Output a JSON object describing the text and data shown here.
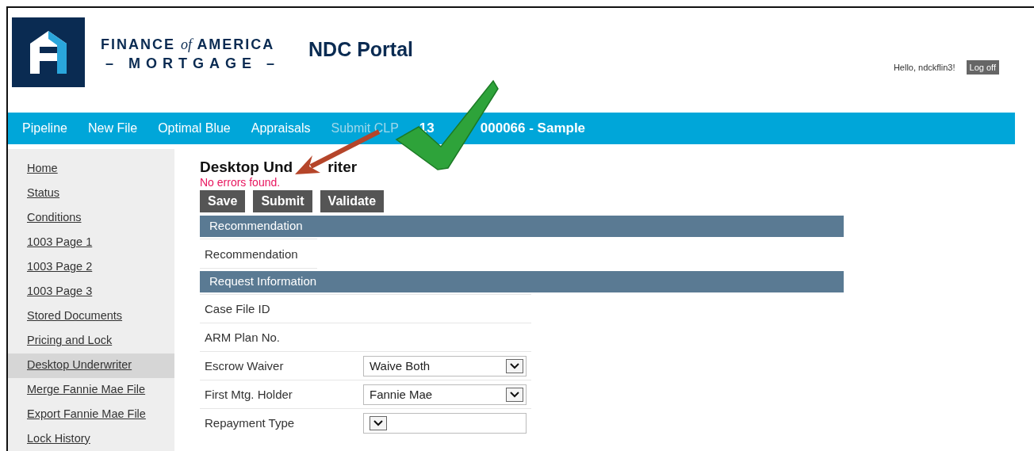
{
  "header": {
    "brand_line1_a": "FINANCE",
    "brand_line1_of": "of",
    "brand_line1_b": "AMERICA",
    "brand_line2": "– MORTGAGE –",
    "portal_title": "NDC Portal",
    "greeting": "Hello, ndckflin3!",
    "logoff": "Log off"
  },
  "nav": {
    "items": [
      {
        "label": "Pipeline",
        "disabled": false
      },
      {
        "label": "New File",
        "disabled": false
      },
      {
        "label": "Optimal Blue",
        "disabled": false
      },
      {
        "label": "Appraisals",
        "disabled": false
      },
      {
        "label": "Submit CLP",
        "disabled": true
      }
    ],
    "loan_parts": [
      "13",
      "000066 - Sample"
    ]
  },
  "sidebar": {
    "items": [
      {
        "label": "Home",
        "selected": false
      },
      {
        "label": "Status",
        "selected": false
      },
      {
        "label": "Conditions",
        "selected": false
      },
      {
        "label": "1003 Page 1",
        "selected": false
      },
      {
        "label": "1003 Page 2",
        "selected": false
      },
      {
        "label": "1003 Page 3",
        "selected": false
      },
      {
        "label": "Stored Documents",
        "selected": false
      },
      {
        "label": "Pricing and Lock",
        "selected": false
      },
      {
        "label": "Desktop Underwriter",
        "selected": true
      },
      {
        "label": "Merge Fannie Mae File",
        "selected": false
      },
      {
        "label": "Export Fannie Mae File",
        "selected": false
      },
      {
        "label": "Lock History",
        "selected": false
      }
    ]
  },
  "page": {
    "title_parts": [
      "Desktop Und",
      "riter"
    ],
    "message": "No errors found.",
    "buttons": [
      "Save",
      "Submit",
      "Validate"
    ]
  },
  "sections": [
    {
      "title": "Recommendation",
      "rows": [
        {
          "kind": "text",
          "label": "Recommendation",
          "short": true
        }
      ]
    },
    {
      "title": "Request Information",
      "rows": [
        {
          "kind": "text",
          "label": "Case File ID",
          "short": false
        },
        {
          "kind": "text",
          "label": "ARM Plan No.",
          "short": false
        },
        {
          "kind": "select",
          "label": "Escrow Waiver",
          "value": "Waive Both",
          "short": false
        },
        {
          "kind": "select",
          "label": "First Mtg. Holder",
          "value": "Fannie Mae",
          "short": false
        },
        {
          "kind": "select",
          "label": "Repayment Type",
          "short": false
        }
      ]
    }
  ]
}
